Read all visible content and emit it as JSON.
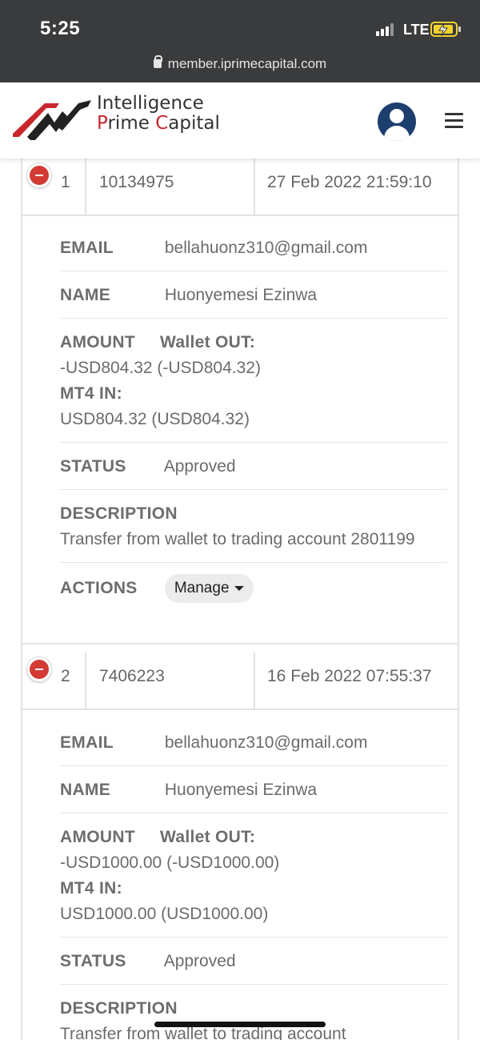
{
  "status_bar": {
    "time": "5:25",
    "network": "LTE",
    "url": "member.iprimecapital.com"
  },
  "header": {
    "logo_line1": "Intelligence",
    "logo_line2_a": "P",
    "logo_line2_b": "rime ",
    "logo_line2_c": "C",
    "logo_line2_d": "apital",
    "brand_color": "#c9262c"
  },
  "labels": {
    "email": "EMAIL",
    "name": "NAME",
    "amount": "AMOUNT",
    "wallet_out": "Wallet OUT:",
    "mt4_in": "MT4 IN:",
    "status": "STATUS",
    "description": "DESCRIPTION",
    "actions": "ACTIONS",
    "manage": "Manage"
  },
  "records": [
    {
      "index": "1",
      "id": "10134975",
      "date": "27 Feb 2022 21:59:10",
      "email": "bellahuonz310@gmail.com",
      "name": "Huonyemesi Ezinwa",
      "wallet_out_value": "-USD804.32 (-USD804.32)",
      "mt4_in_value": "USD804.32 (USD804.32)",
      "status": "Approved",
      "description": "Transfer from wallet to trading account 2801199"
    },
    {
      "index": "2",
      "id": "7406223",
      "date": "16 Feb 2022 07:55:37",
      "email": "bellahuonz310@gmail.com",
      "name": "Huonyemesi Ezinwa",
      "wallet_out_value": "-USD1000.00 (-USD1000.00)",
      "mt4_in_value": "USD1000.00 (USD1000.00)",
      "status": "Approved",
      "description": "Transfer from wallet to trading account"
    }
  ]
}
